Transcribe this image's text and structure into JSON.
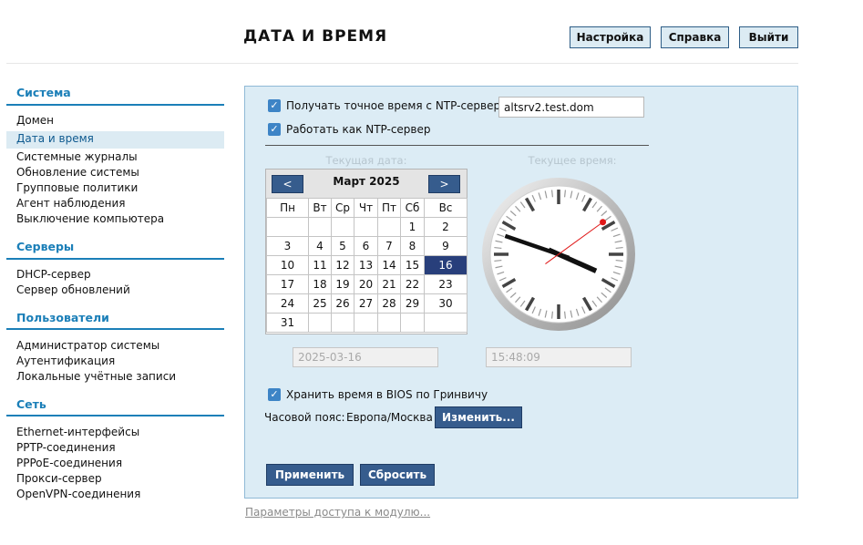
{
  "header": {
    "title": "ДАТА И ВРЕМЯ",
    "buttons": {
      "settings": "Настройка",
      "help": "Справка",
      "logout": "Выйти"
    }
  },
  "sidebar": {
    "sections": [
      {
        "title": "Система",
        "items": [
          "Домен",
          "Дата и время",
          "Системные журналы",
          "Обновление системы",
          "Групповые политики",
          "Агент наблюдения",
          "Выключение компьютера"
        ]
      },
      {
        "title": "Серверы",
        "items": [
          "DHCP-сервер",
          "Сервер обновлений"
        ]
      },
      {
        "title": "Пользователи",
        "items": [
          "Администратор системы",
          "Аутентификация",
          "Локальные учётные записи"
        ]
      },
      {
        "title": "Сеть",
        "items": [
          "Ethernet-интерфейсы",
          "PPTP-соединения",
          "PPPoE-соединения",
          "Прокси-сервер",
          "OpenVPN-соединения"
        ]
      }
    ],
    "active_item": "Дата и время"
  },
  "form": {
    "ntp_get_label": "Получать точное время с NTP-сервера:",
    "ntp_server_value": "altsrv2.test.dom",
    "ntp_get_checked": true,
    "ntp_serve_label": "Работать как NTP-сервер",
    "ntp_serve_checked": true,
    "current_date_label": "Текущая дата:",
    "current_time_label": "Текущее время:",
    "current_date_value": "2025-03-16",
    "current_time_value": "15:48:09",
    "bios_label": "Хранить время в BIOS по Гринвичу",
    "bios_checked": true,
    "timezone_label": "Часовой пояс:",
    "timezone_value": "Европа/Москва",
    "change_button": "Изменить...",
    "apply_button": "Применить",
    "reset_button": "Сбросить"
  },
  "calendar": {
    "month_label": "Март 2025",
    "prev": "<",
    "next": ">",
    "weekdays": [
      "Пн",
      "Вт",
      "Ср",
      "Чт",
      "Пт",
      "Сб",
      "Вс"
    ],
    "weeks": [
      [
        "",
        "",
        "",
        "",
        "",
        "1",
        "2"
      ],
      [
        "3",
        "4",
        "5",
        "6",
        "7",
        "8",
        "9"
      ],
      [
        "10",
        "11",
        "12",
        "13",
        "14",
        "15",
        "16"
      ],
      [
        "17",
        "18",
        "19",
        "20",
        "21",
        "22",
        "23"
      ],
      [
        "24",
        "25",
        "26",
        "27",
        "28",
        "29",
        "30"
      ],
      [
        "31",
        "",
        "",
        "",
        "",
        "",
        ""
      ]
    ],
    "selected_day": "16"
  },
  "clock": {
    "hours": 15,
    "minutes": 48,
    "seconds": 9
  },
  "footer": {
    "access_link": "Параметры доступа к модулю..."
  },
  "colors": {
    "accent": "#1b7fb8",
    "panel_bg": "#dcecf5",
    "button_bg": "#365c8d",
    "selected_day_bg": "#283f7b"
  }
}
